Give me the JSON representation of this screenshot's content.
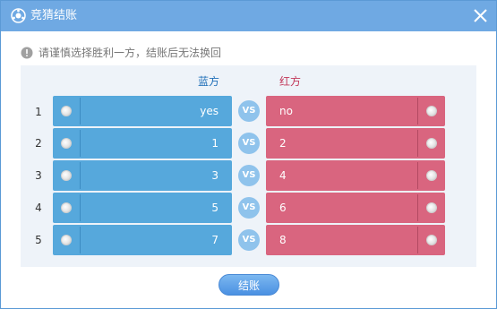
{
  "titlebar": {
    "title": "竞猜结账",
    "icon": "logo-icon",
    "close_icon": "close-icon"
  },
  "notice": {
    "icon": "info-icon",
    "text": "请谨慎选择胜利一方，结账后无法换回"
  },
  "columns": {
    "blue_label": "蓝方",
    "red_label": "红方"
  },
  "vs_label": "VS",
  "rows": [
    {
      "num": "1",
      "blue": "yes",
      "red": "no"
    },
    {
      "num": "2",
      "blue": "1",
      "red": "2"
    },
    {
      "num": "3",
      "blue": "3",
      "red": "4"
    },
    {
      "num": "4",
      "blue": "5",
      "red": "6"
    },
    {
      "num": "5",
      "blue": "7",
      "red": "8"
    }
  ],
  "settle_button": "结账",
  "colors": {
    "titlebar": "#6fa9e3",
    "blue_option": "#56a8dc",
    "red_option": "#d9657f",
    "vs_badge": "#8fc3ec",
    "panel": "#eef3f9"
  }
}
